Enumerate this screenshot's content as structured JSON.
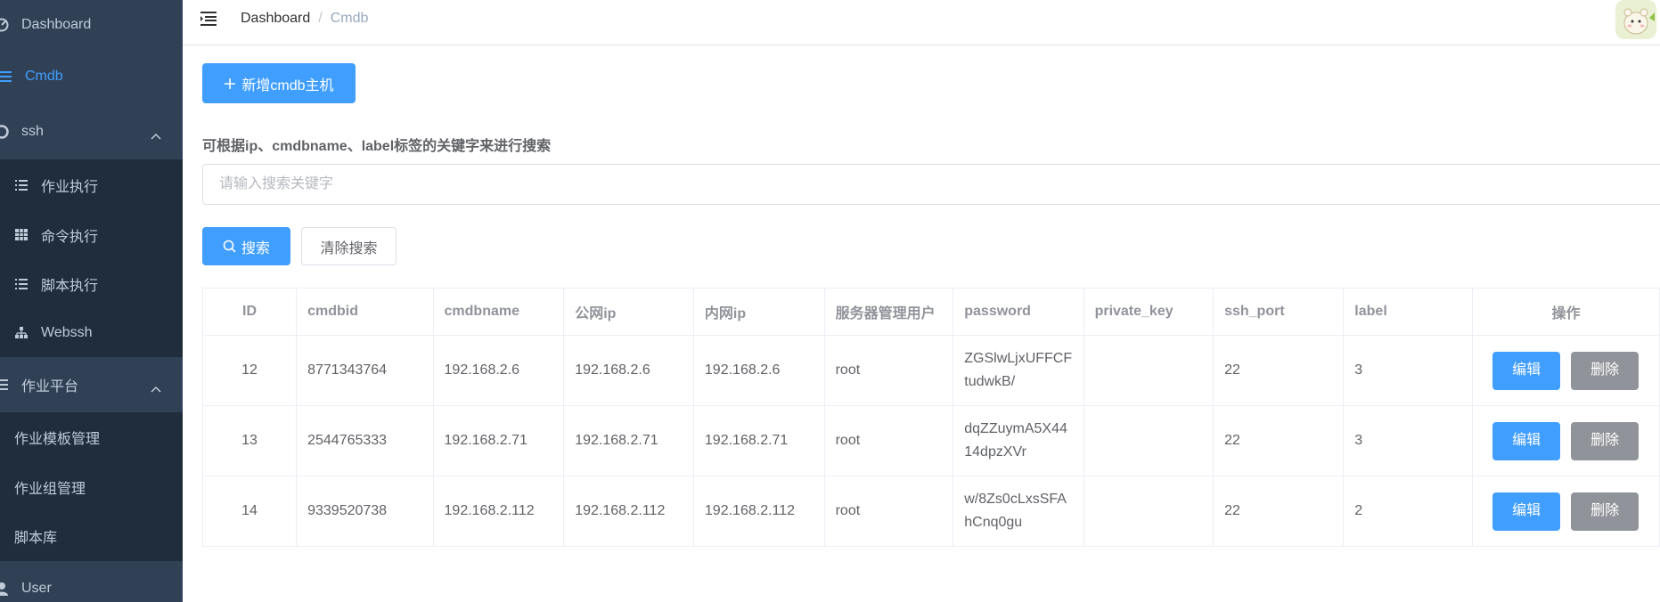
{
  "sidebar": {
    "items": [
      {
        "label": "Dashboard",
        "icon": "dashboard-icon"
      },
      {
        "label": "Cmdb",
        "icon": "list-icon",
        "active": true
      },
      {
        "label": "ssh",
        "icon": "ssh-icon",
        "expanded": true,
        "children": [
          {
            "label": "作业执行",
            "icon": "list-icon"
          },
          {
            "label": "命令执行",
            "icon": "table-icon"
          },
          {
            "label": "脚本执行",
            "icon": "list-icon"
          },
          {
            "label": "Webssh",
            "icon": "tree-icon"
          }
        ]
      },
      {
        "label": "作业平台",
        "icon": "list-icon",
        "expanded": true,
        "children": [
          {
            "label": "作业模板管理"
          },
          {
            "label": "作业组管理"
          },
          {
            "label": "脚本库"
          }
        ]
      },
      {
        "label": "User",
        "icon": "user-icon"
      }
    ]
  },
  "navbar": {
    "breadcrumb": {
      "home": "Dashboard",
      "separator": "/",
      "current": "Cmdb"
    }
  },
  "main": {
    "add_button": "新增cmdb主机",
    "search_hint": "可根据ip、cmdbname、label标签的关键字来进行搜索",
    "search_placeholder": "请输入搜索关键字",
    "search_value": "",
    "search_button": "搜索",
    "clear_button": "清除搜索"
  },
  "table": {
    "columns": [
      "ID",
      "cmdbid",
      "cmdbname",
      "公网ip",
      "内网ip",
      "服务器管理用户",
      "password",
      "private_key",
      "ssh_port",
      "label",
      "操作"
    ],
    "edit_label": "编辑",
    "delete_label": "删除",
    "rows": [
      {
        "id": "12",
        "cmdbid": "8771343764",
        "cmdbname": "192.168.2.6",
        "public_ip": "192.168.2.6",
        "private_ip": "192.168.2.6",
        "user": "root",
        "password": "ZGSlwLjxUFFCFtudwkB/",
        "private_key": "",
        "ssh_port": "22",
        "label": "3"
      },
      {
        "id": "13",
        "cmdbid": "2544765333",
        "cmdbname": "192.168.2.71",
        "public_ip": "192.168.2.71",
        "private_ip": "192.168.2.71",
        "user": "root",
        "password": "dqZZuymA5X4414dpzXVr",
        "private_key": "",
        "ssh_port": "22",
        "label": "3"
      },
      {
        "id": "14",
        "cmdbid": "9339520738",
        "cmdbname": "192.168.2.112",
        "public_ip": "192.168.2.112",
        "private_ip": "192.168.2.112",
        "user": "root",
        "password": "w/8Zs0cLxsSFAhCnq0gu",
        "private_key": "",
        "ssh_port": "22",
        "label": "2"
      }
    ]
  },
  "colors": {
    "sidebar_bg": "#304156",
    "submenu_bg": "#1f2d3d",
    "primary": "#409EFF",
    "info": "#909399"
  }
}
